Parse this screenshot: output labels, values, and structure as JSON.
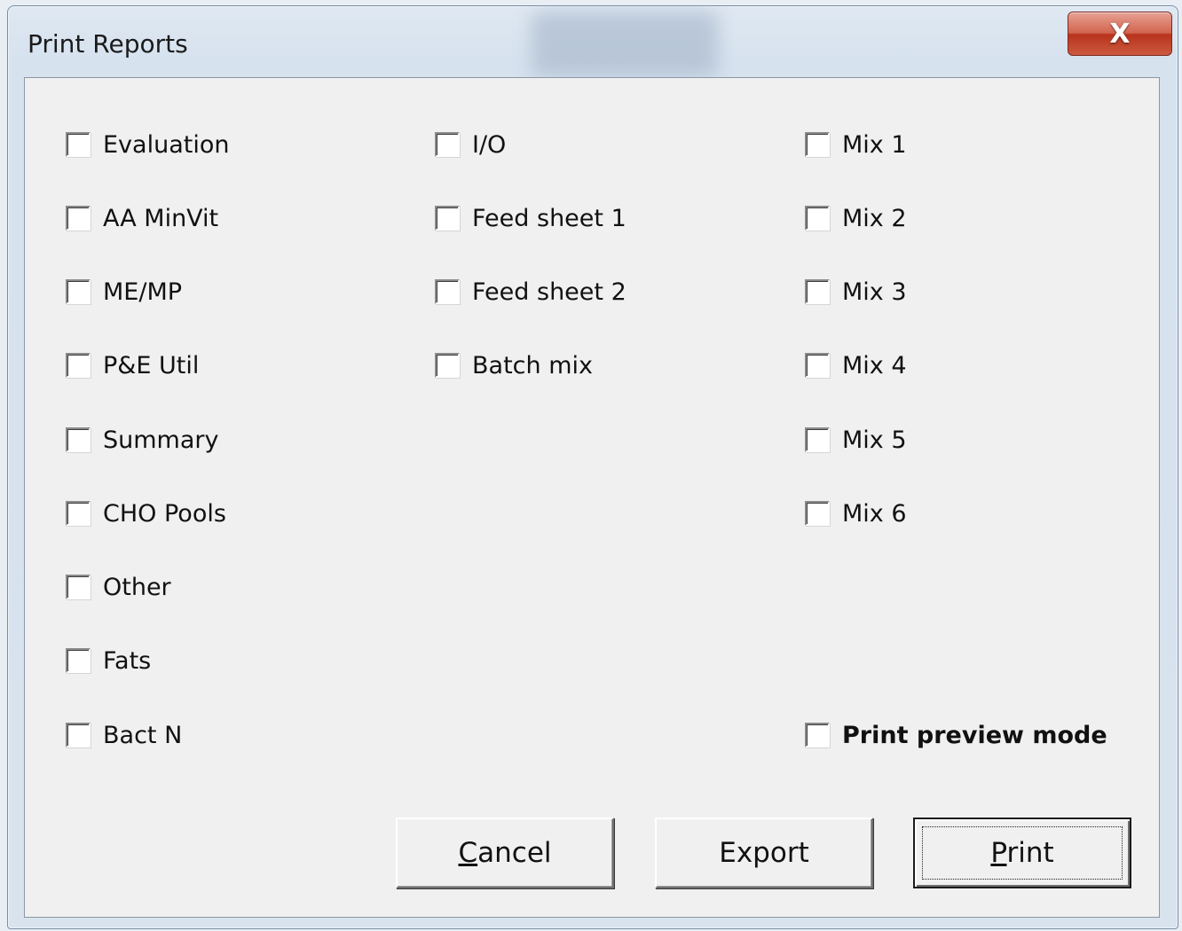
{
  "window": {
    "title": "Print Reports",
    "close_glyph": "X"
  },
  "columns": {
    "left": [
      {
        "label": "Evaluation",
        "checked": false
      },
      {
        "label": "AA MinVit",
        "checked": false
      },
      {
        "label": "ME/MP",
        "checked": false
      },
      {
        "label": "P&E Util",
        "checked": false
      },
      {
        "label": "Summary",
        "checked": false
      },
      {
        "label": "CHO Pools",
        "checked": false
      },
      {
        "label": "Other",
        "checked": false
      },
      {
        "label": "Fats",
        "checked": false
      },
      {
        "label": "Bact N",
        "checked": false
      }
    ],
    "middle": [
      {
        "label": "I/O",
        "checked": false
      },
      {
        "label": "Feed sheet 1",
        "checked": false
      },
      {
        "label": "Feed sheet 2",
        "checked": false
      },
      {
        "label": "Batch mix",
        "checked": false
      }
    ],
    "right": [
      {
        "label": "Mix 1",
        "checked": false
      },
      {
        "label": "Mix 2",
        "checked": false
      },
      {
        "label": "Mix 3",
        "checked": false
      },
      {
        "label": "Mix 4",
        "checked": false
      },
      {
        "label": "Mix 5",
        "checked": false
      },
      {
        "label": "Mix 6",
        "checked": false
      }
    ]
  },
  "print_preview": {
    "label": "Print preview mode",
    "checked": false
  },
  "buttons": {
    "cancel": {
      "accel": "C",
      "rest": "ancel"
    },
    "export": {
      "label": "Export"
    },
    "print": {
      "accel": "P",
      "rest": "rint"
    }
  }
}
